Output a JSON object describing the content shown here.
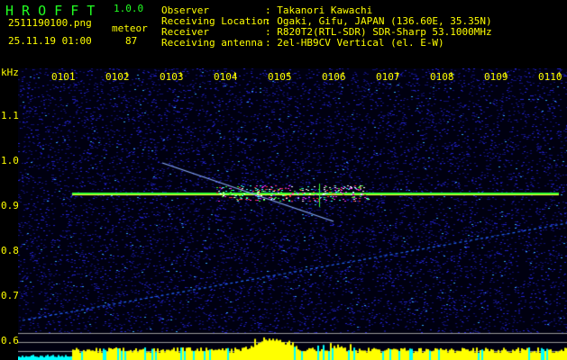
{
  "app": {
    "name": "H R O F F T",
    "version": "1.0.0"
  },
  "file": {
    "name": "2511190100.png",
    "datetime": "25.11.19 01:00"
  },
  "meteor": {
    "label": "meteor",
    "count": "87"
  },
  "info": [
    {
      "key": "Observer",
      "value": "Takanori Kawachi"
    },
    {
      "key": "Receiving Location",
      "value": "Ogaki, Gifu, JAPAN (136.60E, 35.35N)"
    },
    {
      "key": "Receiver",
      "value": "R820T2(RTL-SDR) SDR-Sharp 53.1000MHz"
    },
    {
      "key": "Receiving antenna",
      "value": "2el-HB9CV Vertical (el. E-W)"
    }
  ],
  "axis": {
    "unit": "kHz",
    "y_ticks": [
      "1.1",
      "1.0",
      "0.9",
      "0.8",
      "0.7",
      "0.6"
    ],
    "x_ticks": [
      "0101",
      "0102",
      "0103",
      "0104",
      "0105",
      "0106",
      "0107",
      "0108",
      "0109",
      "0110"
    ]
  },
  "colors": {
    "title": "#22ee22",
    "text": "#ffff00",
    "carrier": "#33ff33"
  }
}
